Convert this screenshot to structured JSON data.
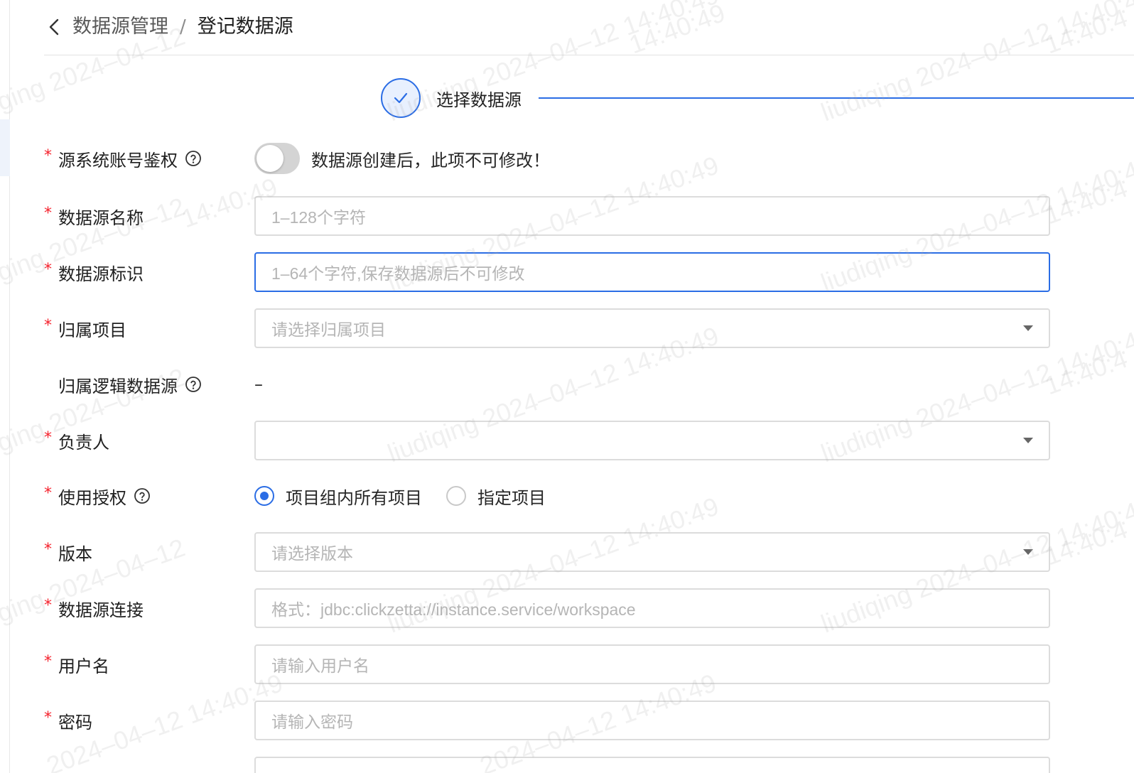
{
  "breadcrumb": {
    "parent": "数据源管理",
    "separator": "/",
    "current": "登记数据源"
  },
  "steps": [
    {
      "label": "选择数据源",
      "status": "done"
    }
  ],
  "form": {
    "auth": {
      "label": "源系统账号鉴权",
      "required": true,
      "switch_on": false,
      "note": "数据源创建后，此项不可修改！"
    },
    "name": {
      "label": "数据源名称",
      "required": true,
      "value": "",
      "placeholder": "1–128个字符"
    },
    "identifier": {
      "label": "数据源标识",
      "required": true,
      "value": "",
      "placeholder": "1–64个字符,保存数据源后不可修改"
    },
    "project": {
      "label": "归属项目",
      "required": true,
      "placeholder": "请选择归属项目"
    },
    "logical_source": {
      "label": "归属逻辑数据源",
      "required": false,
      "value": "–"
    },
    "owner": {
      "label": "负责人",
      "required": true,
      "value": ""
    },
    "usage_auth": {
      "label": "使用授权",
      "required": true,
      "options": [
        "项目组内所有项目",
        "指定项目"
      ],
      "selected": "项目组内所有项目"
    },
    "version": {
      "label": "版本",
      "required": true,
      "placeholder": "请选择版本"
    },
    "connection": {
      "label": "数据源连接",
      "required": true,
      "placeholder": "格式：jdbc:clickzetta://instance.service/workspace"
    },
    "username": {
      "label": "用户名",
      "required": true,
      "placeholder": "请输入用户名"
    },
    "password": {
      "label": "密码",
      "required": true,
      "placeholder": "请输入密码"
    }
  },
  "watermark": {
    "full": "liudiqing 2024–04–12 14:40:49",
    "partial_a": "2024–04–12 14:40:49",
    "partial_b": "14:40:49",
    "partial_c": "ging 2024–04–12",
    "partial_d": "14:40:4"
  },
  "colors": {
    "primary": "#2b6de5",
    "required": "#f5222d",
    "border": "#dcdcdc",
    "placeholder": "#b5b5b5"
  }
}
